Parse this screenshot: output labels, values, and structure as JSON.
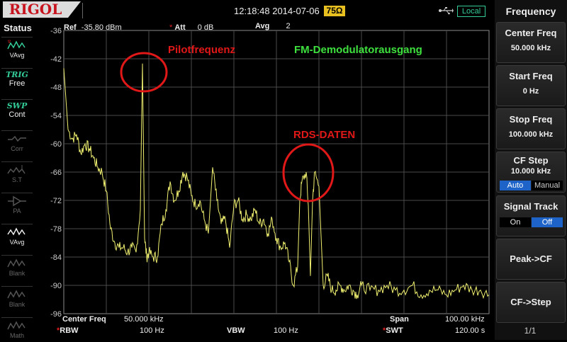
{
  "topbar": {
    "logo": "RIGOL",
    "datetime": "12:18:48 2014-07-06",
    "impedance": "75Ω",
    "remote_mode": "Local",
    "usb_icon": "usb-icon"
  },
  "status": {
    "title": "Status",
    "items": [
      {
        "name": "vavg-icon",
        "label": "VAvg",
        "active": true
      },
      {
        "name": "trig",
        "big": "TRIG",
        "sub": "Free",
        "active": true
      },
      {
        "name": "swp",
        "big": "SWP",
        "sub": "Cont",
        "active": true
      },
      {
        "name": "corr-icon",
        "label": "Corr",
        "active": false
      },
      {
        "name": "st-icon",
        "label": "S.T",
        "active": false
      },
      {
        "name": "pa-icon",
        "label": "PA",
        "active": false
      },
      {
        "name": "vavg2-icon",
        "label": "VAvg",
        "active": true
      },
      {
        "name": "blank-icon",
        "label": "Blank",
        "active": false
      },
      {
        "name": "blank2-icon",
        "label": "Blank",
        "active": false
      },
      {
        "name": "math-icon",
        "label": "Math",
        "active": false
      }
    ]
  },
  "header": {
    "ref_label": "Ref",
    "ref_value": "-35.80 dBm",
    "att_label": "Att",
    "att_value": "0 dB",
    "avg_label": "Avg",
    "avg_value": "2"
  },
  "annotations": {
    "pilot": "Pilotfrequenz",
    "fm": "FM-Demodulatorausgang",
    "rds": "RDS-DATEN"
  },
  "footer": {
    "center_label": "Center Freq",
    "center_value": "50.000 kHz",
    "span_label": "Span",
    "span_value": "100.00 kHz",
    "rbw_label": "RBW",
    "rbw_value": "100 Hz",
    "vbw_label": "VBW",
    "vbw_value": "100 Hz",
    "swt_label": "SWT",
    "swt_value": "120.00 s"
  },
  "chart_data": {
    "type": "line",
    "ylim": [
      -96,
      -36
    ],
    "yticks": [
      "-36",
      "-42",
      "-48",
      "-54",
      "-60",
      "-66",
      "-72",
      "-78",
      "-84",
      "-90",
      "-96"
    ],
    "xlim": [
      0,
      100
    ],
    "x_unit": "kHz",
    "y_unit": "dBm",
    "grid": true,
    "trace_color": "#f0f070",
    "series": [
      {
        "x": [
          0,
          1,
          2,
          3,
          4,
          5,
          6,
          7,
          8,
          9,
          10,
          11,
          12,
          13,
          14,
          15,
          16,
          17,
          18,
          18.5,
          19,
          19.5,
          20,
          21,
          22,
          23,
          24,
          25,
          26,
          27,
          28,
          29,
          30,
          31,
          32,
          33,
          34,
          35,
          36,
          37,
          38,
          39,
          40,
          41,
          42,
          43,
          44,
          45,
          46,
          47,
          48,
          49,
          50,
          51,
          52,
          53,
          54,
          55,
          55.5,
          56,
          57,
          57.5,
          58,
          58.5,
          59,
          60,
          61,
          62,
          63,
          64,
          65,
          66,
          67,
          68,
          69,
          70,
          72,
          74,
          76,
          78,
          80,
          82,
          84,
          86,
          88,
          90,
          92,
          94,
          96,
          98,
          100
        ],
        "y": [
          -44,
          -57,
          -59,
          -58,
          -62,
          -60,
          -61,
          -63,
          -65,
          -66,
          -70,
          -78,
          -81,
          -82,
          -82,
          -83,
          -82,
          -83,
          -74,
          -43,
          -80,
          -84,
          -83,
          -84,
          -84,
          -77,
          -74,
          -68,
          -72,
          -70,
          -66,
          -67,
          -71,
          -73,
          -72,
          -76,
          -79,
          -65,
          -72,
          -77,
          -76,
          -82,
          -73,
          -72,
          -76,
          -75,
          -76,
          -74,
          -77,
          -76,
          -79,
          -76,
          -80,
          -82,
          -81,
          -85,
          -90,
          -86,
          -72,
          -68,
          -66,
          -73,
          -88,
          -72,
          -66,
          -69,
          -90,
          -88,
          -91,
          -91,
          -90,
          -91,
          -90,
          -91,
          -92,
          -90,
          -91,
          -91,
          -90,
          -91,
          -91,
          -90,
          -92,
          -91,
          -91,
          -92,
          -91,
          -90,
          -91,
          -91,
          -92
        ]
      }
    ]
  },
  "menu": {
    "title": "Frequency",
    "center_freq": {
      "label": "Center Freq",
      "value": "50.000 kHz"
    },
    "start_freq": {
      "label": "Start Freq",
      "value": "0 Hz"
    },
    "stop_freq": {
      "label": "Stop Freq",
      "value": "100.000 kHz"
    },
    "cf_step": {
      "label": "CF Step",
      "value": "10.000 kHz",
      "opt_auto": "Auto",
      "opt_manual": "Manual"
    },
    "signal_track": {
      "label": "Signal Track",
      "opt_on": "On",
      "opt_off": "Off"
    },
    "peak_cf": {
      "label": "Peak->CF"
    },
    "cf_step_key": {
      "label": "CF->Step"
    },
    "page": "1/1"
  }
}
